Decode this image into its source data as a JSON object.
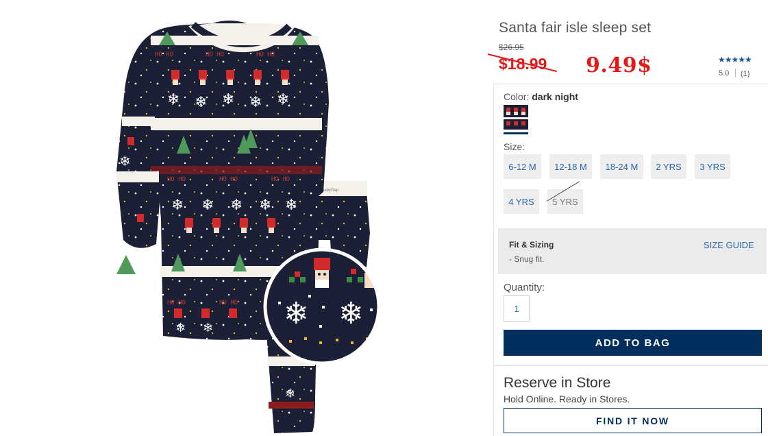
{
  "product": {
    "title": "Santa fair isle sleep set",
    "original_price": "$26.95",
    "sale_price": "$18.99",
    "handwritten_price": "9.49$",
    "rating": {
      "stars": "★★★★★",
      "score": "5.0",
      "count": "(1)"
    }
  },
  "color": {
    "label": "Color: ",
    "value": "dark night"
  },
  "size": {
    "label": "Size:",
    "options": [
      {
        "label": "6-12 M",
        "available": true
      },
      {
        "label": "12-18 M",
        "available": true
      },
      {
        "label": "18-24 M",
        "available": true
      },
      {
        "label": "2 YRS",
        "available": true
      },
      {
        "label": "3 YRS",
        "available": true
      },
      {
        "label": "4 YRS",
        "available": true
      },
      {
        "label": "5 YRS",
        "available": false
      }
    ]
  },
  "fit": {
    "title": "Fit & Sizing",
    "text": "- Snug fit.",
    "size_guide": "SIZE GUIDE"
  },
  "quantity": {
    "label": "Quantity:",
    "value": "1"
  },
  "actions": {
    "add_to_bag": "ADD TO BAG"
  },
  "reserve": {
    "title": "Reserve in Store",
    "subtitle": "Hold Online. Ready in Stores.",
    "find_button": "FIND IT NOW"
  },
  "image": {
    "pants_label": "babyGap",
    "pattern_text": "HO HO"
  },
  "colors": {
    "navy": "#002e5d",
    "link_blue": "#2a66a8",
    "price_red": "#e21a1a",
    "pajama_navy": "#1b2036"
  }
}
